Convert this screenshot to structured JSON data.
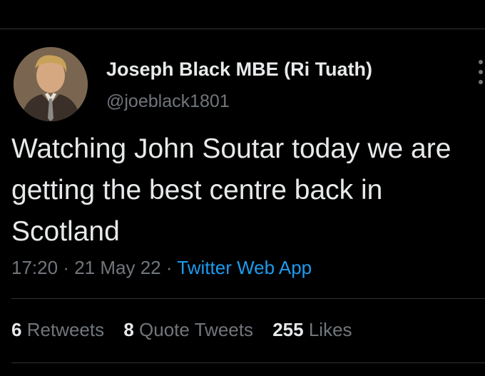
{
  "author": {
    "name": "Joseph Black MBE (Ri Tuath)",
    "handle": "@joeblack1801",
    "avatar_icon": "profile-photo"
  },
  "tweet": {
    "text": "Watching John Soutar today we are getting the best centre back in Scotland",
    "time": "17:20",
    "separator": "·",
    "date": "21 May 22",
    "source": "Twitter Web App"
  },
  "stats": {
    "retweets_count": "6",
    "retweets_label": "Retweets",
    "quotes_count": "8",
    "quotes_label": "Quote Tweets",
    "likes_count": "255",
    "likes_label": "Likes"
  },
  "colors": {
    "background": "#000000",
    "text": "#e7e9ea",
    "secondary": "#71767b",
    "link": "#1d9bf0",
    "divider": "#2f3336"
  }
}
